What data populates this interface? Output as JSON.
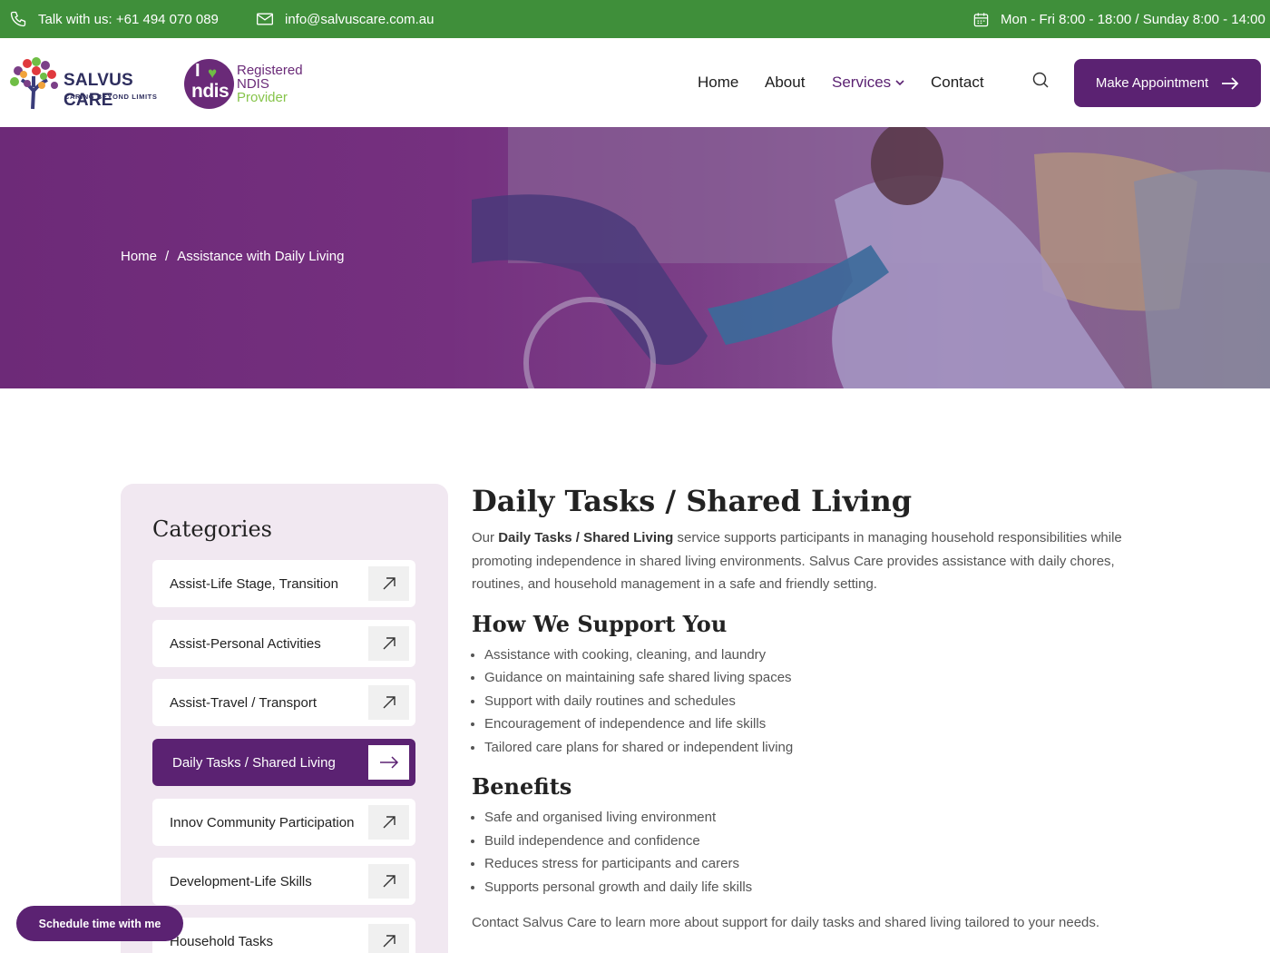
{
  "topbar": {
    "phone": "Talk with us: +61 494 070 089",
    "email": "info@salvuscare.com.au",
    "hours": "Mon - Fri 8:00 - 18:00 / Sunday 8:00 - 14:00"
  },
  "header": {
    "logo_brand": "SALVUS CARE",
    "logo_tagline": "CARING BEYOND LIMITS",
    "ndis_line1": "Registered",
    "ndis_line2": "NDIS",
    "ndis_line3": "Provider",
    "ndis_mark": "ndis",
    "nav": {
      "home": "Home",
      "about": "About",
      "services": "Services",
      "contact": "Contact"
    },
    "cta": "Make Appointment"
  },
  "hero": {
    "crumb_home": "Home",
    "crumb_sep": "/",
    "crumb_current": "Assistance with Daily Living"
  },
  "sidebar": {
    "title": "Categories",
    "items": [
      "Assist-Life Stage, Transition",
      "Assist-Personal Activities",
      "Assist-Travel / Transport",
      "Daily Tasks / Shared Living",
      "Innov Community Participation",
      "Development-Life Skills",
      "Household Tasks"
    ]
  },
  "content": {
    "title": "Daily Tasks / Shared Living",
    "intro_pre": "Our ",
    "intro_bold": "Daily Tasks / Shared Living",
    "intro_post": " service supports participants in managing household responsibilities while promoting independence in shared living environments. Salvus Care provides assistance with daily chores, routines, and household management in a safe and friendly setting.",
    "support_heading": "How We Support You",
    "support_items": [
      "Assistance with cooking, cleaning, and laundry",
      "Guidance on maintaining safe shared living spaces",
      "Support with daily routines and schedules",
      "Encouragement of independence and life skills",
      "Tailored care plans for shared or independent living"
    ],
    "benefits_heading": "Benefits",
    "benefit_items": [
      "Safe and organised living environment",
      "Build independence and confidence",
      "Reduces stress for participants and carers",
      "Supports personal growth and daily life skills"
    ],
    "outro": "Contact Salvus Care to learn more about support for daily tasks and shared living tailored to your needs."
  },
  "schedule_button": "Schedule time with me",
  "colors": {
    "topbar_green": "#3f8f3a",
    "brand_purple": "#5b2272"
  }
}
